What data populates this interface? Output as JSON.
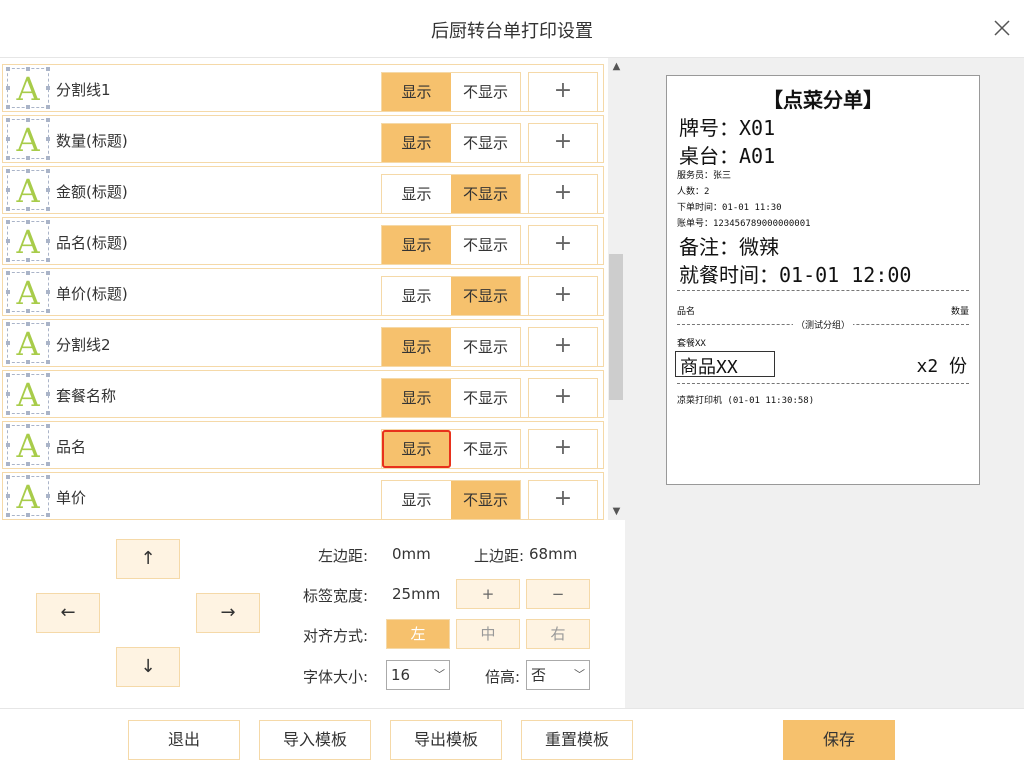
{
  "dialog": {
    "title": "后厨转台单打印设置"
  },
  "field_rows": [
    {
      "label": "分割线1",
      "show": "显示",
      "hide": "不显示",
      "state": "show",
      "add": "+"
    },
    {
      "label": "数量(标题)",
      "show": "显示",
      "hide": "不显示",
      "state": "show",
      "add": "+"
    },
    {
      "label": "金额(标题)",
      "show": "显示",
      "hide": "不显示",
      "state": "hide",
      "add": "+"
    },
    {
      "label": "品名(标题)",
      "show": "显示",
      "hide": "不显示",
      "state": "show",
      "add": "+"
    },
    {
      "label": "单价(标题)",
      "show": "显示",
      "hide": "不显示",
      "state": "hide",
      "add": "+"
    },
    {
      "label": "分割线2",
      "show": "显示",
      "hide": "不显示",
      "state": "show",
      "add": "+"
    },
    {
      "label": "套餐名称",
      "show": "显示",
      "hide": "不显示",
      "state": "show",
      "add": "+"
    },
    {
      "label": "品名",
      "show": "显示",
      "hide": "不显示",
      "state": "show",
      "add": "+",
      "focused": true
    },
    {
      "label": "单价",
      "show": "显示",
      "hide": "不显示",
      "state": "hide",
      "add": "+"
    }
  ],
  "row_icon_letter": "A",
  "receipt": {
    "title": "【点菜分单】",
    "plate": "牌号：X01",
    "table": "桌台：A01",
    "waiter": "服务员：张三",
    "guests": "人数：2",
    "order_time": "下单时间：01-01 11:30",
    "bill_no": "账单号：123456789000000001",
    "remark": "备注：微辣",
    "dining_time": "就餐时间：01-01 12:00",
    "col_name": "品名",
    "col_qty": "数量",
    "group": "（测试分组）",
    "set_name": "套餐XX",
    "item_name": "商品XX",
    "item_qty": "x2 份",
    "printer": "凉菜打印机 (01-01 11:30:58)"
  },
  "controls": {
    "up": "↑",
    "down": "↓",
    "left": "←",
    "right": "→",
    "left_margin_label": "左边距:",
    "left_margin_value": "0mm",
    "top_margin_label": "上边距:",
    "top_margin_value": "68mm",
    "label_width_label": "标签宽度:",
    "label_width_value": "25mm",
    "plus": "+",
    "minus": "−",
    "align_label": "对齐方式:",
    "align_left": "左",
    "align_center": "中",
    "align_right": "右",
    "font_size_label": "字体大小:",
    "font_size_value": "16",
    "double_height_label": "倍高:",
    "double_height_value": "否"
  },
  "footer": {
    "exit": "退出",
    "import": "导入模板",
    "export": "导出模板",
    "reset": "重置模板",
    "save": "保存"
  },
  "colors": {
    "accent": "#f6c16d",
    "border": "#f5d9a8",
    "icon_letter": "#a8cc4a",
    "focus_outline": "#e8311c"
  }
}
